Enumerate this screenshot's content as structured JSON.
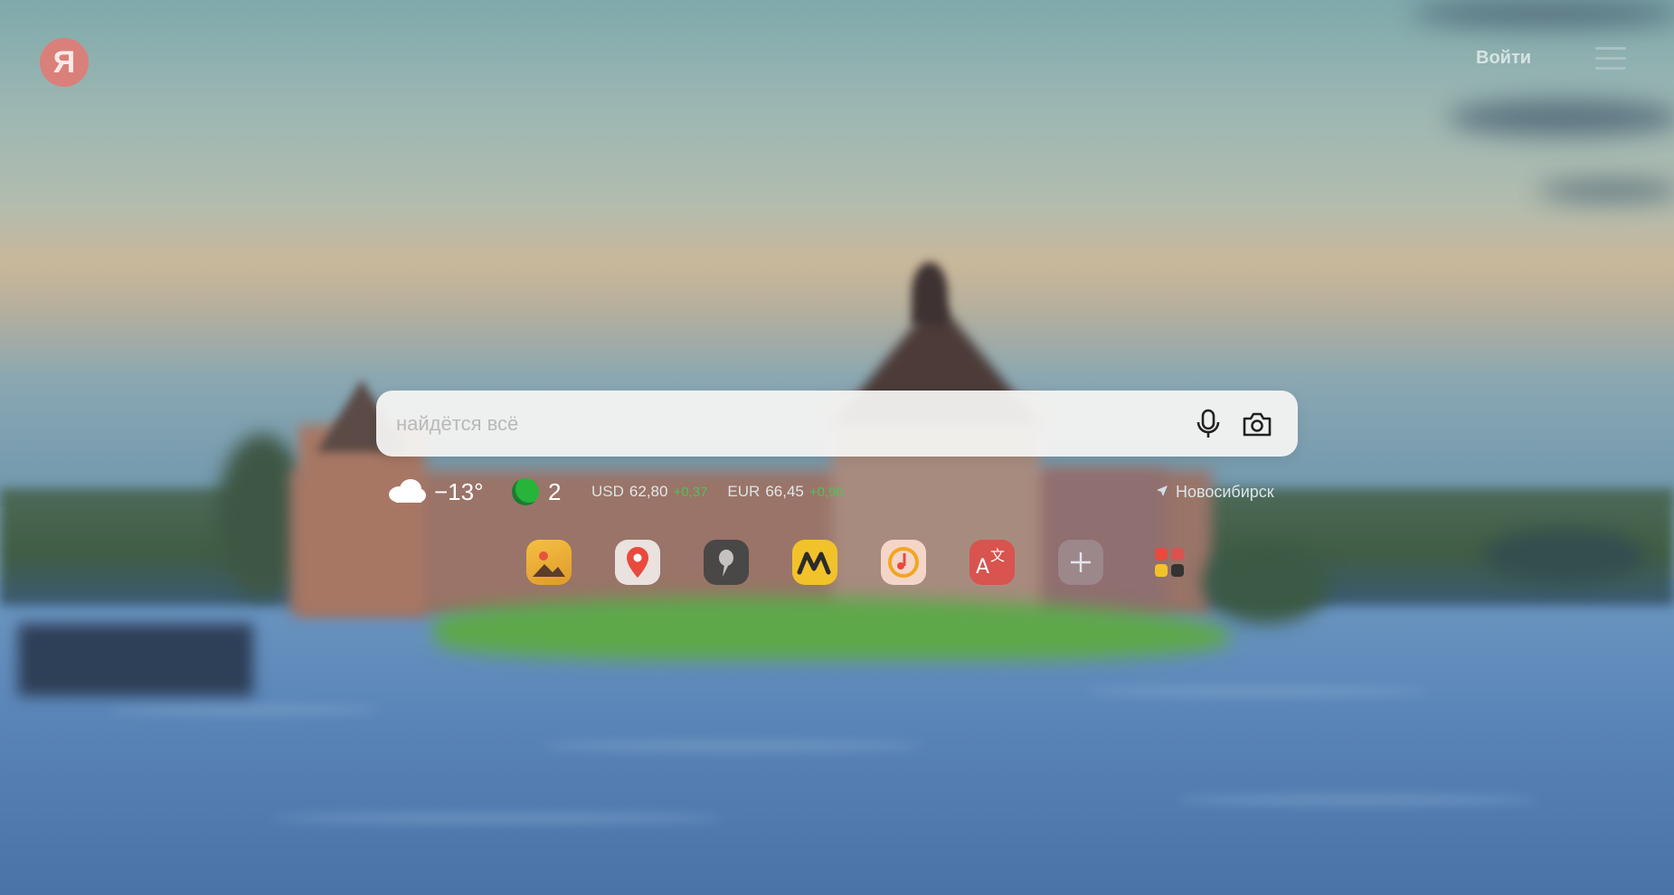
{
  "header": {
    "logo_letter": "Я",
    "login_label": "Войти",
    "menu_icon": "hamburger-menu-icon"
  },
  "search": {
    "placeholder": "найдётся всё",
    "voice_icon": "microphone-icon",
    "camera_icon": "camera-search-icon"
  },
  "widgets": {
    "weather": {
      "icon": "cloud-icon",
      "temperature": "−13°"
    },
    "traffic": {
      "icon": "traffic-light-icon",
      "level": "2",
      "color": "#26b43a"
    },
    "rates": [
      {
        "name": "USD",
        "value": "62,80",
        "change": "+0,37"
      },
      {
        "name": "EUR",
        "value": "66,45",
        "change": "+0,90"
      }
    ],
    "location": {
      "icon": "location-arrow-icon",
      "city": "Новосибирск"
    }
  },
  "services": [
    {
      "icon": "images-icon"
    },
    {
      "icon": "maps-icon"
    },
    {
      "icon": "alice-icon"
    },
    {
      "icon": "market-icon"
    },
    {
      "icon": "music-icon"
    },
    {
      "icon": "translate-icon"
    },
    {
      "icon": "add-service-icon"
    },
    {
      "icon": "all-services-icon"
    }
  ],
  "colors": {
    "logo": "#d9807b",
    "rate_change_positive": "#4fc25a"
  }
}
